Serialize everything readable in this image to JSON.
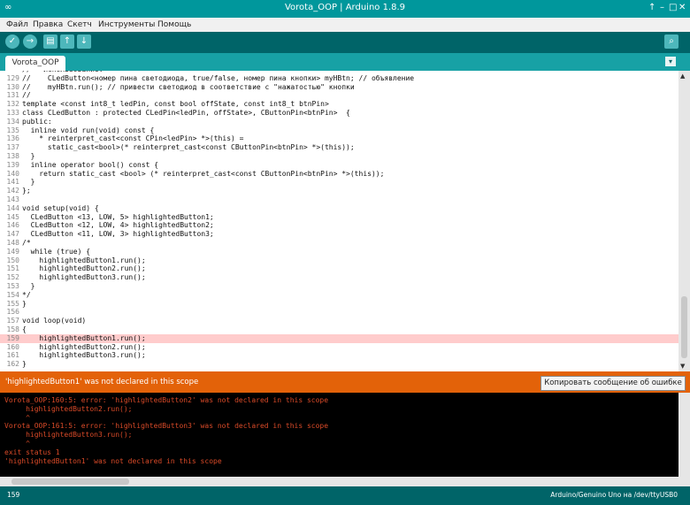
{
  "window": {
    "title": "Vorota_OOP | Arduino 1.8.9",
    "logo": "∞",
    "controls": [
      "↑",
      "–",
      "□",
      "✕"
    ]
  },
  "menu": [
    "Файл",
    "Правка",
    "Скетч",
    "Инструменты",
    "Помощь"
  ],
  "toolbar": {
    "buttons": [
      {
        "name": "verify-button",
        "icon": "✓",
        "shape": "round"
      },
      {
        "name": "upload-button",
        "icon": "→",
        "shape": "round"
      },
      {
        "name": "new-button",
        "icon": "▤",
        "shape": "sq"
      },
      {
        "name": "open-button",
        "icon": "↑",
        "shape": "sq"
      },
      {
        "name": "save-button",
        "icon": "↓",
        "shape": "sq"
      }
    ],
    "serial_monitor_icon": "⌕"
  },
  "tabs": [
    {
      "label": "Vorota_OOP"
    }
  ],
  "tab_menu_icon": "▾",
  "editor": {
    "highlight_line": "159",
    "lines": [
      {
        "num": "",
        "code": "//   Использование:"
      },
      {
        "num": "129",
        "code": "//    CLedButton<номер пина светодиода, true/false, номер пина кнопки> myHBtn; // объявление"
      },
      {
        "num": "130",
        "code": "//    myHBtn.run(); // привести светодиод в соответствие с \"нажатостью\" кнопки"
      },
      {
        "num": "131",
        "code": "//"
      },
      {
        "num": "132",
        "code": "template <const int8_t ledPin, const bool offState, const int8_t btnPin>"
      },
      {
        "num": "133",
        "code": "class CLedButton : protected CLedPin<ledPin, offState>, CButtonPin<btnPin>  {"
      },
      {
        "num": "134",
        "code": "public:"
      },
      {
        "num": "135",
        "code": "  inline void run(void) const {"
      },
      {
        "num": "136",
        "code": "    * reinterpret_cast<const CPin<ledPin> *>(this) ="
      },
      {
        "num": "137",
        "code": "      static_cast<bool>(* reinterpret_cast<const CButtonPin<btnPin> *>(this));"
      },
      {
        "num": "138",
        "code": "  }"
      },
      {
        "num": "139",
        "code": "  inline operator bool() const {"
      },
      {
        "num": "140",
        "code": "    return static_cast <bool> (* reinterpret_cast<const CButtonPin<btnPin> *>(this));"
      },
      {
        "num": "141",
        "code": "  }"
      },
      {
        "num": "142",
        "code": "};"
      },
      {
        "num": "143",
        "code": ""
      },
      {
        "num": "144",
        "code": "void setup(void) {"
      },
      {
        "num": "145",
        "code": "  CLedButton <13, LOW, 5> highlightedButton1;"
      },
      {
        "num": "146",
        "code": "  CLedButton <12, LOW, 4> highlightedButton2;"
      },
      {
        "num": "147",
        "code": "  CLedButton <11, LOW, 3> highlightedButton3;"
      },
      {
        "num": "148",
        "code": "/*"
      },
      {
        "num": "149",
        "code": "  while (true) {"
      },
      {
        "num": "150",
        "code": "    highlightedButton1.run();"
      },
      {
        "num": "151",
        "code": "    highlightedButton2.run();"
      },
      {
        "num": "152",
        "code": "    highlightedButton3.run();"
      },
      {
        "num": "153",
        "code": "  }"
      },
      {
        "num": "154",
        "code": "*/"
      },
      {
        "num": "155",
        "code": "}"
      },
      {
        "num": "156",
        "code": ""
      },
      {
        "num": "157",
        "code": "void loop(void)"
      },
      {
        "num": "158",
        "code": "{"
      },
      {
        "num": "159",
        "code": "    highlightedButton1.run();"
      },
      {
        "num": "160",
        "code": "    highlightedButton2.run();"
      },
      {
        "num": "161",
        "code": "    highlightedButton3.run();"
      },
      {
        "num": "162",
        "code": "}"
      }
    ]
  },
  "error_bar": {
    "message": "'highlightedButton1' was not declared in this scope",
    "copy_button": "Копировать сообщение об ошибке"
  },
  "console": {
    "lines": [
      "Vorota_OOP:160:5: error: 'highlightedButton2' was not declared in this scope",
      "     highlightedButton2.run();",
      "     ^",
      "Vorota_OOP:161:5: error: 'highlightedButton3' was not declared in this scope",
      "     highlightedButton3.run();",
      "     ^",
      "exit status 1",
      "'highlightedButton1' was not declared in this scope"
    ]
  },
  "status": {
    "line_number": "159",
    "board": "Arduino/Genuino Uno на /dev/ttyUSB0"
  }
}
